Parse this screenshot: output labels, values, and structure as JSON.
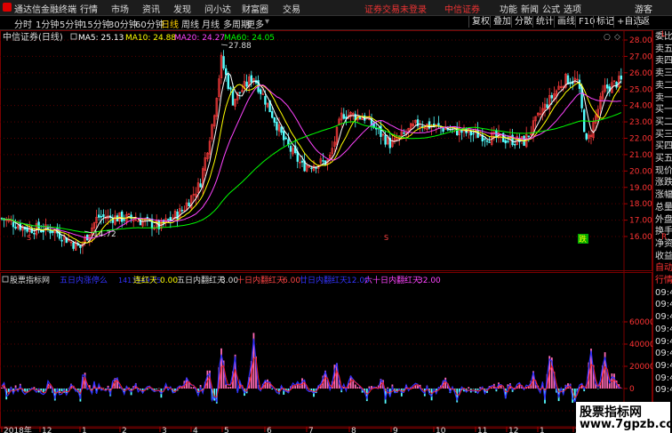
{
  "menubar": {
    "app_title": "通达信金融终端",
    "menus": [
      "行情",
      "市场",
      "资讯",
      "发现",
      "问小达",
      "财富圈",
      "交易"
    ],
    "login_notice": "证券交易未登录",
    "broker": "中信证券",
    "right_items": [
      "功能",
      "新闻",
      "公式",
      "选项"
    ],
    "user": "游客"
  },
  "toolbar": {
    "periods": [
      "分时",
      "1分钟",
      "5分钟",
      "15分钟",
      "30分钟",
      "60分钟",
      "日线",
      "周线",
      "月线",
      "多周期",
      "更多"
    ],
    "active_period": "日线",
    "right_buttons": [
      "复权",
      "叠加",
      "分散",
      "统计",
      "画线",
      "F10",
      "标记",
      "+自选",
      "返回"
    ]
  },
  "main_chart": {
    "title": "中信证券(日线)",
    "ma5_label": "MA5: 25.13",
    "ma10_label": "MA10: 24.88",
    "ma20_label": "MA20: 24.27",
    "ma60_label": "MA60: 24.05",
    "high_label": "27.88",
    "low_label": "14.72",
    "y_ticks": [
      "28.00",
      "27.00",
      "26.00",
      "25.00",
      "24.00",
      "23.00",
      "22.00",
      "21.00",
      "20.00",
      "19.00",
      "18.00",
      "17.00",
      "16.00"
    ],
    "colors": {
      "ma5": "#ffffff",
      "ma10": "#ffff00",
      "ma20": "#ff44ff",
      "ma60": "#00ff00",
      "up": "#ff3c3c",
      "down": "#54ffff"
    },
    "signals": [
      "S",
      "S",
      "跌"
    ]
  },
  "indicator": {
    "name": "股票指标网",
    "f1_label": "五日内涨停么",
    "f1_value": "1413549.75",
    "f2_label": "连红天",
    "f2_value": "0.00",
    "f3_label": "五日内翻红天",
    "f3_value": "3.00",
    "f4_label": "十日内翻红天",
    "f4_value": "6.00",
    "f5_label": "廿日内翻红天",
    "f5_value": "12.00",
    "f6_label": "六十日内翻红天",
    "f6_value": "32.00",
    "y_ticks": [
      "60000",
      "40000",
      "20000",
      "0",
      "-20000"
    ]
  },
  "x_axis": {
    "labels": [
      "2018年",
      "12",
      "1",
      "2",
      "3",
      "4",
      "5",
      "6",
      "7",
      "8",
      "9",
      "10",
      "11",
      "12",
      "1",
      "2"
    ]
  },
  "right_panel": {
    "items": [
      {
        "t": "委比",
        "c": "normal"
      },
      {
        "t": "卖五",
        "c": "normal"
      },
      {
        "t": "卖四",
        "c": "normal"
      },
      {
        "t": "卖三",
        "c": "normal"
      },
      {
        "t": "卖二",
        "c": "normal"
      },
      {
        "t": "卖一",
        "c": "normal"
      },
      {
        "t": "买一",
        "c": "normal"
      },
      {
        "t": "买二",
        "c": "normal"
      },
      {
        "t": "买三",
        "c": "normal"
      },
      {
        "t": "买四",
        "c": "normal"
      },
      {
        "t": "买五",
        "c": "normal"
      },
      {
        "t": "现价",
        "c": "normal"
      },
      {
        "t": "涨跌",
        "c": "normal"
      },
      {
        "t": "涨幅",
        "c": "normal"
      },
      {
        "t": "总量",
        "c": "normal"
      },
      {
        "t": "外盘",
        "c": "normal"
      },
      {
        "t": "换手",
        "c": "normal"
      },
      {
        "t": "净资",
        "c": "normal"
      },
      {
        "t": "收益",
        "c": "normal"
      },
      {
        "t": "自动",
        "c": "red"
      },
      {
        "t": "行情",
        "c": "red"
      },
      {
        "t": "09:4",
        "c": "normal"
      },
      {
        "t": "09:4",
        "c": "normal"
      },
      {
        "t": "09:4",
        "c": "normal"
      },
      {
        "t": "09:4",
        "c": "normal"
      },
      {
        "t": "09:4",
        "c": "normal"
      },
      {
        "t": "09:4",
        "c": "normal"
      },
      {
        "t": "09:4",
        "c": "normal"
      },
      {
        "t": "09:4",
        "c": "normal"
      },
      {
        "t": "09:4",
        "c": "normal"
      }
    ],
    "side_marks": [
      "L",
      "R"
    ]
  },
  "watermark": {
    "line1": "股票指标网",
    "line2": "www.7gpzb.com"
  }
}
